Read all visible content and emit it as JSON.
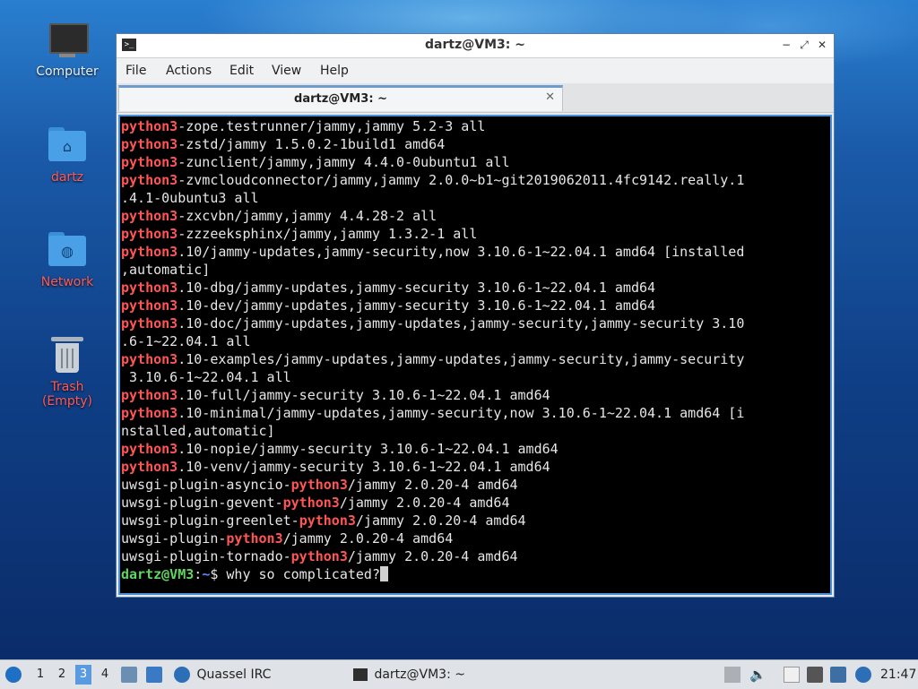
{
  "desktop": {
    "icons": [
      {
        "label": "Computer"
      },
      {
        "label": "dartz"
      },
      {
        "label": "Network"
      },
      {
        "label": "Trash (Empty)"
      }
    ]
  },
  "window": {
    "title": "dartz@VM3: ~",
    "menu": [
      "File",
      "Actions",
      "Edit",
      "View",
      "Help"
    ],
    "tab_title": "dartz@VM3: ~",
    "tab_close": "✕"
  },
  "terminal": {
    "highlight_color": "#ff5555",
    "lines": [
      [
        "",
        "python3",
        "-zope.testrunner/jammy,jammy 5.2-3 all"
      ],
      [
        "",
        "python3",
        "-zstd/jammy 1.5.0.2-1build1 amd64"
      ],
      [
        "",
        "python3",
        "-zunclient/jammy,jammy 4.4.0-0ubuntu1 all"
      ],
      [
        "",
        "python3",
        "-zvmcloudconnector/jammy,jammy 2.0.0~b1~git2019062011.4fc9142.really.1"
      ],
      [
        ".4.1-0ubuntu3 all",
        "",
        ""
      ],
      [
        "",
        "python3",
        "-zxcvbn/jammy,jammy 4.4.28-2 all"
      ],
      [
        "",
        "python3",
        "-zzzeeksphinx/jammy,jammy 1.3.2-1 all"
      ],
      [
        "",
        "python3",
        ".10/jammy-updates,jammy-security,now 3.10.6-1~22.04.1 amd64 [installed"
      ],
      [
        ",automatic]",
        "",
        ""
      ],
      [
        "",
        "python3",
        ".10-dbg/jammy-updates,jammy-security 3.10.6-1~22.04.1 amd64"
      ],
      [
        "",
        "python3",
        ".10-dev/jammy-updates,jammy-security 3.10.6-1~22.04.1 amd64"
      ],
      [
        "",
        "python3",
        ".10-doc/jammy-updates,jammy-updates,jammy-security,jammy-security 3.10"
      ],
      [
        ".6-1~22.04.1 all",
        "",
        ""
      ],
      [
        "",
        "python3",
        ".10-examples/jammy-updates,jammy-updates,jammy-security,jammy-security"
      ],
      [
        " 3.10.6-1~22.04.1 all",
        "",
        ""
      ],
      [
        "",
        "python3",
        ".10-full/jammy-security 3.10.6-1~22.04.1 amd64"
      ],
      [
        "",
        "python3",
        ".10-minimal/jammy-updates,jammy-security,now 3.10.6-1~22.04.1 amd64 [i"
      ],
      [
        "nstalled,automatic]",
        "",
        ""
      ],
      [
        "",
        "python3",
        ".10-nopie/jammy-security 3.10.6-1~22.04.1 amd64"
      ],
      [
        "",
        "python3",
        ".10-venv/jammy-security 3.10.6-1~22.04.1 amd64"
      ],
      [
        "uwsgi-plugin-asyncio-",
        "python3",
        "/jammy 2.0.20-4 amd64"
      ],
      [
        "uwsgi-plugin-gevent-",
        "python3",
        "/jammy 2.0.20-4 amd64"
      ],
      [
        "uwsgi-plugin-greenlet-",
        "python3",
        "/jammy 2.0.20-4 amd64"
      ],
      [
        "uwsgi-plugin-",
        "python3",
        "/jammy 2.0.20-4 amd64"
      ],
      [
        "uwsgi-plugin-tornado-",
        "python3",
        "/jammy 2.0.20-4 amd64"
      ]
    ],
    "prompt": {
      "user_host": "dartz@VM3",
      "colon": ":",
      "path": "~",
      "dollar": "$ ",
      "command": "why so complicated?"
    }
  },
  "taskbar": {
    "workspaces": [
      "1",
      "2",
      "3",
      "4"
    ],
    "active_workspace": "3",
    "tasks": [
      {
        "label": "Quassel IRC"
      },
      {
        "label": "dartz@VM3: ~"
      }
    ],
    "clock": "21:47"
  }
}
